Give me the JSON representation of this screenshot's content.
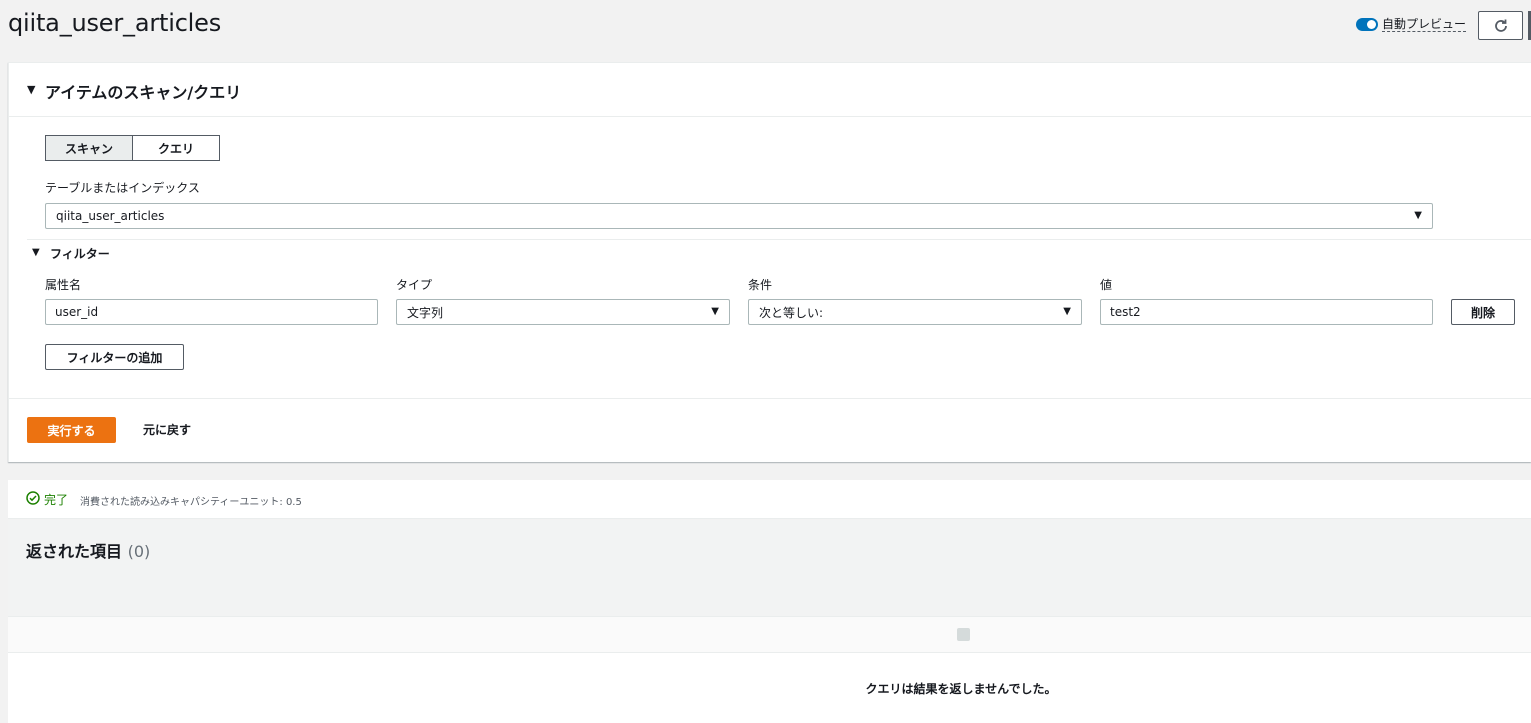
{
  "header": {
    "title": "qiita_user_articles",
    "auto_preview_label": "自動プレビュー",
    "auto_preview_on": true,
    "refresh_icon": "refresh-icon"
  },
  "panel": {
    "title": "アイテムのスキャン/クエリ",
    "mode_tabs": [
      {
        "label": "スキャン",
        "active": true
      },
      {
        "label": "クエリ",
        "active": false
      }
    ],
    "table_label": "テーブルまたはインデックス",
    "table_value": "qiita_user_articles",
    "filter": {
      "title": "フィルター",
      "attr_label": "属性名",
      "type_label": "タイプ",
      "cond_label": "条件",
      "value_label": "値",
      "attr_value": "user_id",
      "type_value": "文字列",
      "cond_value": "次と等しい:",
      "value_value": "test2",
      "delete_label": "削除",
      "add_label": "フィルターの追加"
    },
    "run_label": "実行する",
    "reset_label": "元に戻す"
  },
  "status": {
    "state": "完了",
    "detail": "消費された読み込みキャパシティーユニット: 0.5",
    "color": "#1d8102"
  },
  "results": {
    "title": "返された項目",
    "count": "(0)",
    "empty_message": "クエリは結果を返しませんでした。"
  },
  "colors": {
    "primary": "#ec7211",
    "toggle": "#0073bb"
  }
}
